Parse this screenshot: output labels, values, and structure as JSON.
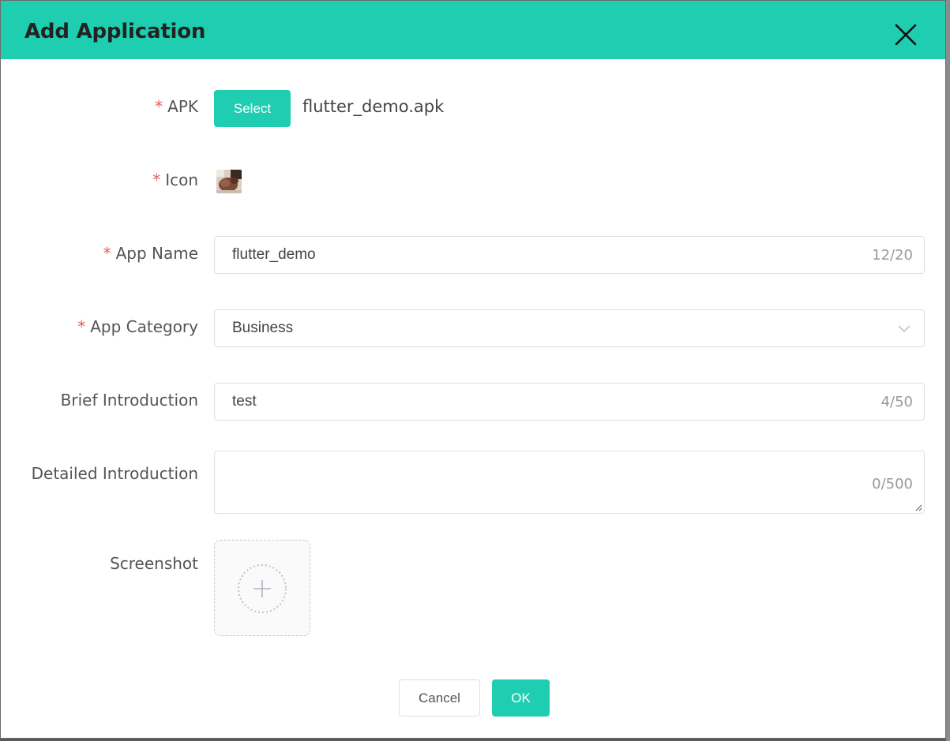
{
  "dialog": {
    "title": "Add Application",
    "close_icon": "close-icon"
  },
  "form": {
    "required_marker": "*",
    "apk": {
      "label": "APK",
      "button_label": "Select",
      "file_name": "flutter_demo.apk"
    },
    "icon": {
      "label": "Icon",
      "image": "app-icon-thumbnail"
    },
    "app_name": {
      "label": "App Name",
      "value": "flutter_demo",
      "counter": "12/20"
    },
    "app_category": {
      "label": "App Category",
      "value": "Business",
      "icon": "chevron-down-icon"
    },
    "brief_introduction": {
      "label": "Brief Introduction",
      "value": "test",
      "counter": "4/50"
    },
    "detailed_introduction": {
      "label": "Detailed Introduction",
      "value": "",
      "counter": "0/500"
    },
    "screenshot": {
      "label": "Screenshot",
      "icon": "plus-icon"
    }
  },
  "footer": {
    "cancel_label": "Cancel",
    "ok_label": "OK"
  },
  "colors": {
    "accent": "#1fcdb0",
    "required": "#e55b5b",
    "border": "#dcdfe6",
    "text": "#555555"
  }
}
